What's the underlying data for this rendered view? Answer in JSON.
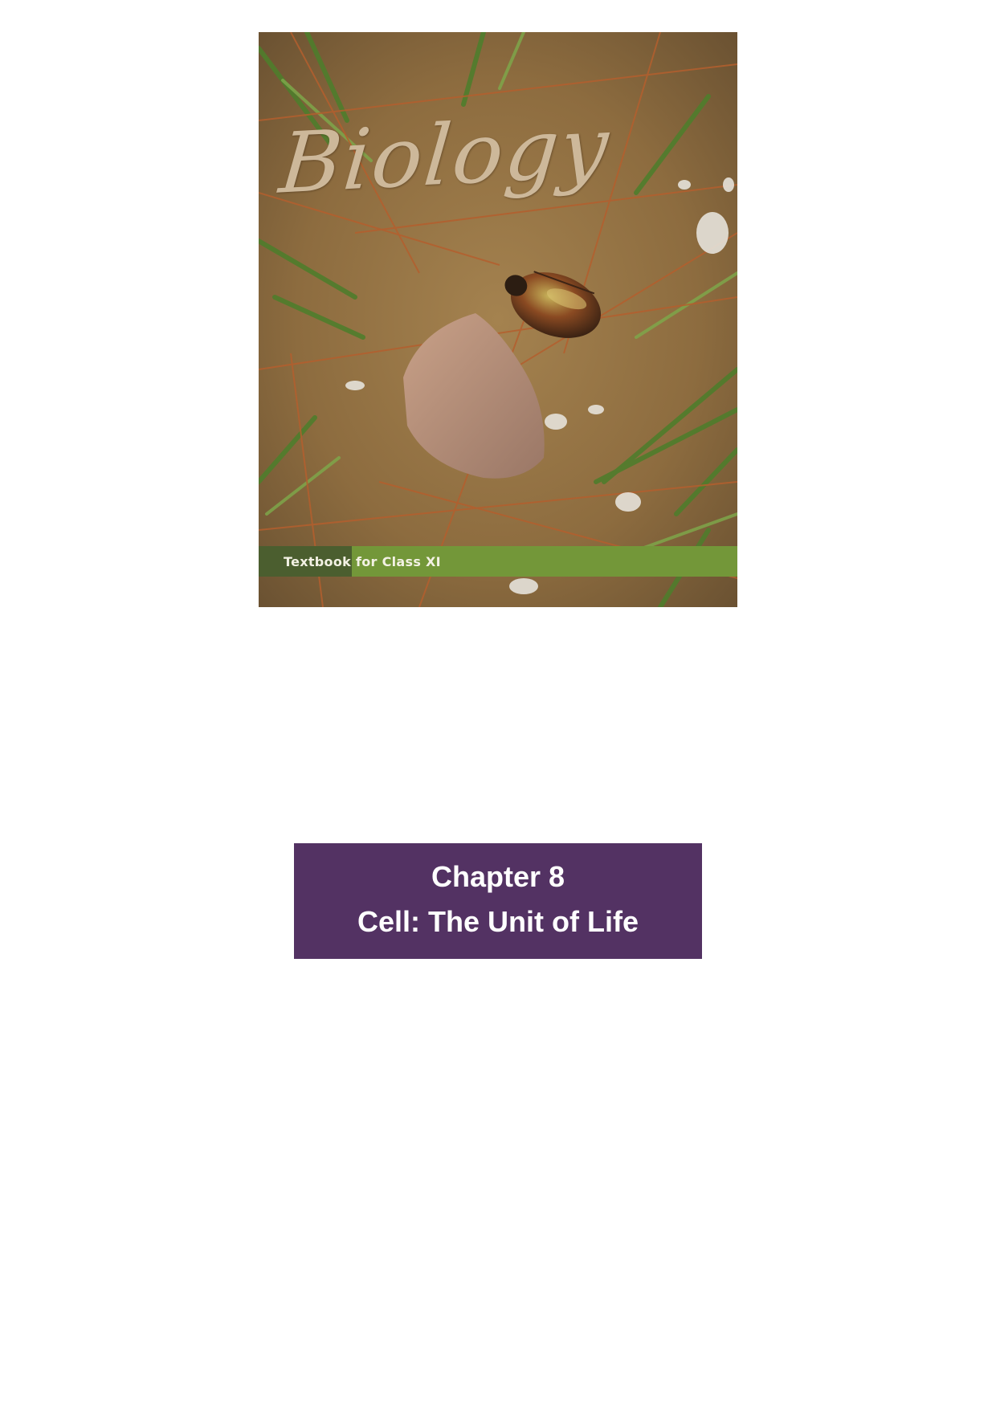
{
  "cover": {
    "title": "Biology",
    "subtitle": "Textbook for Class XI",
    "image_description_icon": "beetle-on-soil-photo",
    "band_color": "#739739",
    "title_color": "#cdb89a"
  },
  "chapter": {
    "number": "Chapter 8",
    "title": "Cell: The Unit of Life",
    "box_color": "#533263"
  }
}
